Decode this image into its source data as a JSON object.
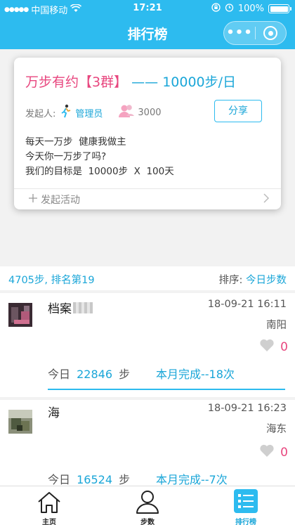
{
  "status_bar": {
    "carrier": "中国移动",
    "time": "17:21",
    "battery": "100%"
  },
  "nav": {
    "title": "排行榜",
    "menu_label": "•••"
  },
  "event": {
    "name": "万步有约【3群】",
    "dash": "——",
    "goal": "10000步/日",
    "initiator_label": "发起人:",
    "initiator_name": "管理员",
    "member_count": "3000",
    "share_label": "分享",
    "description": "每天一万步  健康我做主\n今天你一万步了吗?\n我们的目标是  10000步  X  100天",
    "launch_label": "发起活动"
  },
  "my_rank": {
    "summary": "4705步, 排名第19",
    "sort_label": "排序:",
    "sort_value": "今日步数"
  },
  "entries": [
    {
      "name": "档案",
      "datetime": "18-09-21 16:11",
      "city": "南阳",
      "likes": "0",
      "today_label": "今日",
      "today_steps": "22846",
      "steps_unit": "步",
      "month": "本月完成--18次"
    },
    {
      "name": "海",
      "datetime": "18-09-21 16:23",
      "city": "海东",
      "likes": "0",
      "today_label": "今日",
      "today_steps": "16524",
      "steps_unit": "步",
      "month": "本月完成--7次"
    }
  ],
  "tabs": [
    {
      "label": "主页",
      "icon": "home-icon"
    },
    {
      "label": "步数",
      "icon": "user-icon"
    },
    {
      "label": "排行榜",
      "icon": "list-icon",
      "active": true
    }
  ],
  "colors": {
    "brand": "#2dbbef",
    "accent_pink": "#e8477f",
    "link_blue": "#1aa6d8"
  }
}
